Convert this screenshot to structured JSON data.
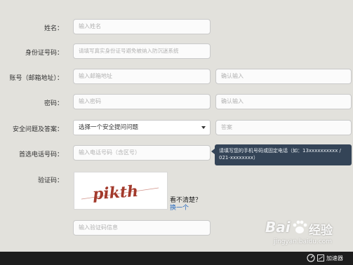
{
  "form": {
    "name": {
      "label": "姓名：",
      "placeholder": "输入姓名"
    },
    "id_number": {
      "label": "身份证号码：",
      "placeholder": "请填写真实身份证号避免被纳入防沉迷系统"
    },
    "account": {
      "label": "账号（邮箱地址）：",
      "placeholder": "输入邮箱地址",
      "confirm_placeholder": "确认输入"
    },
    "password": {
      "label": "密码：",
      "placeholder": "输入密码",
      "confirm_placeholder": "确认输入"
    },
    "security": {
      "label": "安全问题及答案：",
      "selected": "选择一个安全提问问题",
      "answer_placeholder": "答案"
    },
    "phone": {
      "label": "首选电话号码：",
      "placeholder": "输入电话号码（含区号）",
      "tooltip_line1": "请填写您的手机号码或固定电话（如：13xxxxxxxxxx /",
      "tooltip_line2": "021-xxxxxxxx）"
    },
    "captcha": {
      "label": "验证码：",
      "image_text": "pikth",
      "unclear_text": "看不清楚？",
      "refresh_link": "换一个",
      "placeholder": "输入验证码信息"
    }
  },
  "watermark": {
    "brand": "Bai",
    "brand_suffix": "经验",
    "url": "jingyan.baidu.com"
  },
  "taskbar": {
    "accelerator_label": "加速器"
  }
}
